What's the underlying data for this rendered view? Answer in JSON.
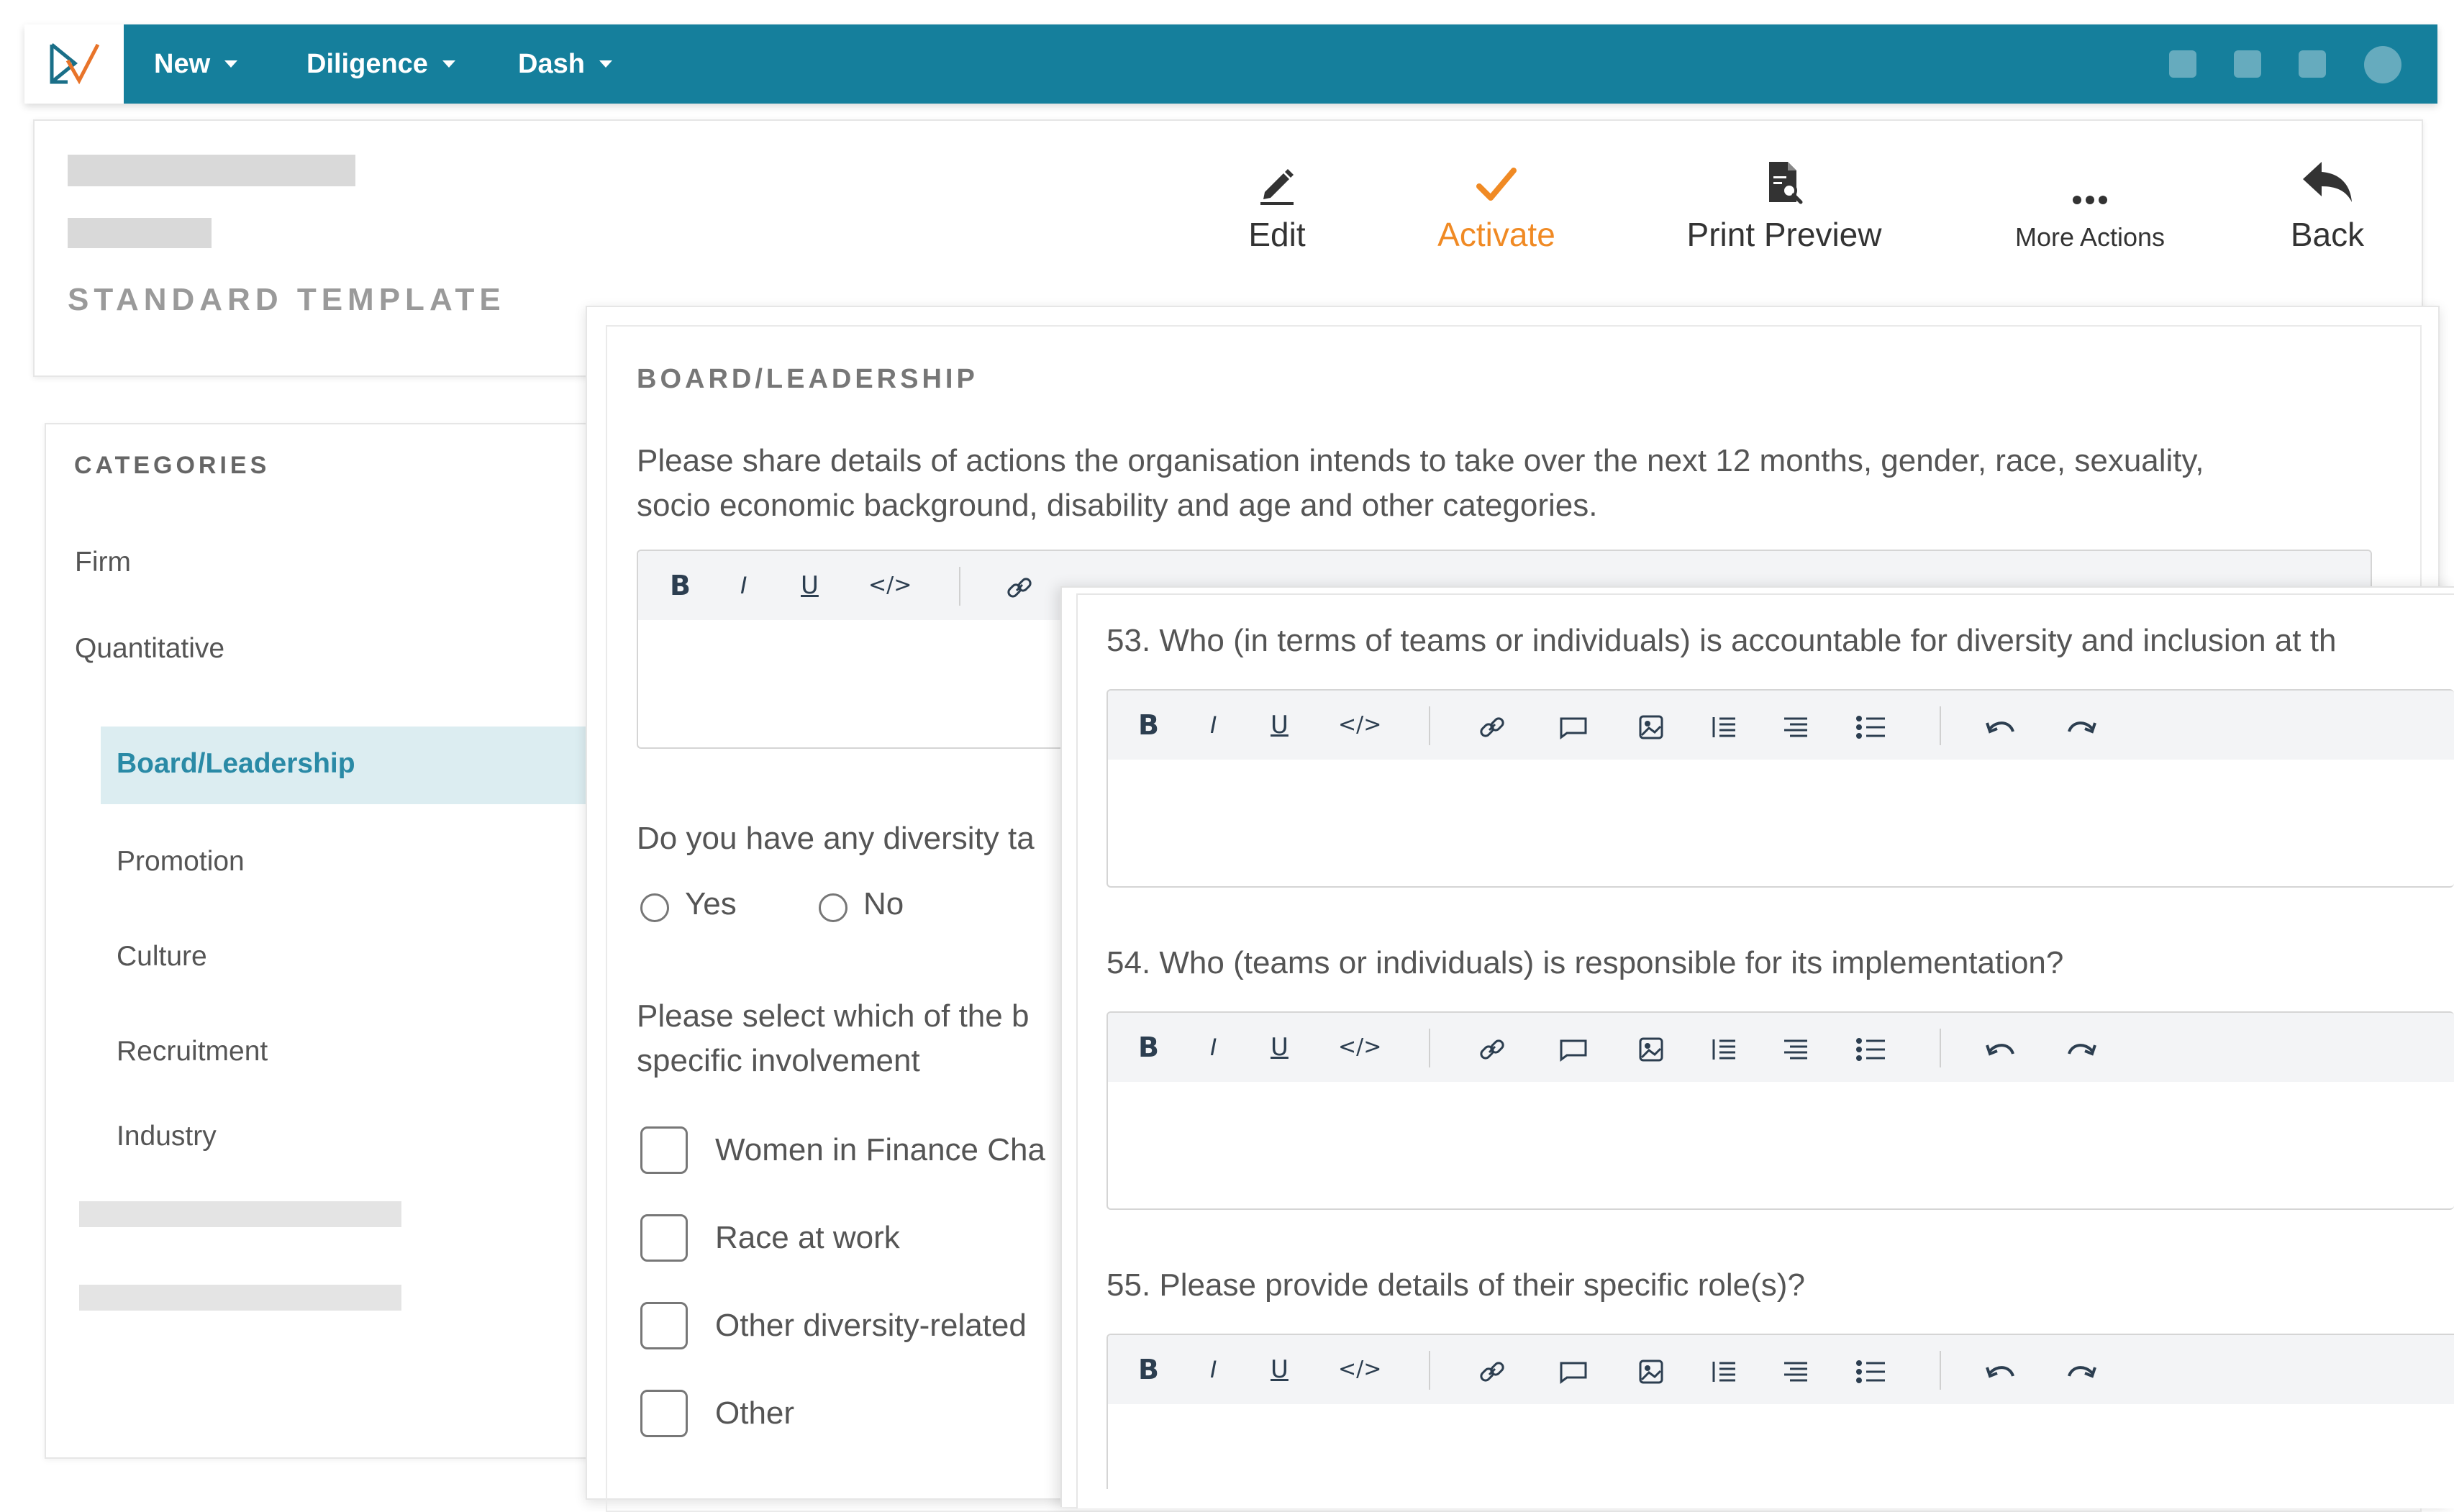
{
  "nav": {
    "items": [
      {
        "label": "New"
      },
      {
        "label": "Diligence"
      },
      {
        "label": "Dash"
      }
    ]
  },
  "header": {
    "template_label": "STANDARD TEMPLATE",
    "actions": {
      "edit": "Edit",
      "activate": "Activate",
      "print_preview": "Print Preview",
      "more_actions": "More Actions",
      "back": "Back"
    }
  },
  "sidebar": {
    "title": "CATEGORIES",
    "items": [
      {
        "label": "Firm"
      },
      {
        "label": "Quantitative"
      },
      {
        "label": "Board/Leadership",
        "active": true
      },
      {
        "label": "Promotion"
      },
      {
        "label": "Culture"
      },
      {
        "label": "Recruitment"
      },
      {
        "label": "Industry"
      }
    ]
  },
  "section": {
    "title": "BOARD/LEADERSHIP",
    "question_intro_line1": "Please share details of actions the organisation intends to take over the next 12 months, gender, race, sexuality,",
    "question_intro_line2": "socio economic background, disability and age and other categories.",
    "question_targets": "Do you have any diversity ta",
    "radio_yes": "Yes",
    "radio_no": "No",
    "question_select_line1": "Please select which of the b",
    "question_select_line2": "specific involvement",
    "checkboxes": [
      {
        "label": "Women in Finance Cha"
      },
      {
        "label": "Race at work"
      },
      {
        "label": "Other diversity-related"
      },
      {
        "label": "Other"
      }
    ]
  },
  "questions": {
    "q53": "53. Who (in terms of teams or individuals) is accountable for diversity and inclusion at th",
    "q54": "54. Who (teams or individuals) is responsible for its implementation?",
    "q55": "55. Please provide details of their specific role(s)?"
  },
  "toolbar": {
    "bold": "B",
    "italic": "I",
    "underline": "U",
    "code": "</>"
  },
  "colors": {
    "nav_bg": "#157f9c",
    "accent_orange": "#f08a24",
    "active_item_bg": "#dcedf1",
    "active_item_text": "#2a8aa6"
  }
}
